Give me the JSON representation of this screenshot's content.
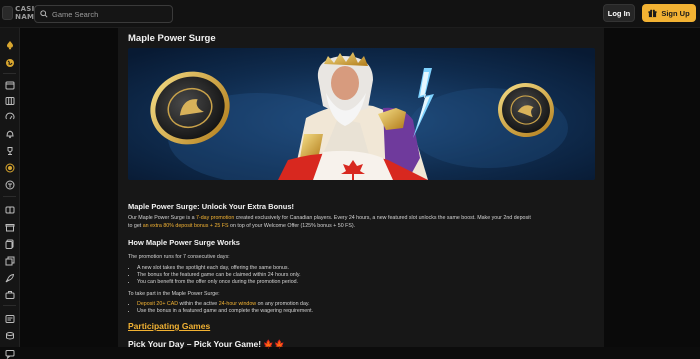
{
  "header": {
    "logo_text": "CASINO NAME",
    "search_placeholder": "Game Search",
    "login_label": "Log In",
    "signup_label": "Sign Up"
  },
  "sidebar": {
    "icons": [
      "spade-icon",
      "world-icon",
      "calendar-icon",
      "slot-machine-icon",
      "speed-icon",
      "bell-icon",
      "trophy-icon",
      "target-icon",
      "dice-icon",
      "slots-reel-icon",
      "gift-icon",
      "card-stack-icon",
      "copy-icon",
      "rocket-icon",
      "briefcase-icon",
      "coins-icon"
    ]
  },
  "article": {
    "title": "Maple Power Surge",
    "hero_alt": "Zeus with Canadian flag and golden coins",
    "heading_1": "Maple Power Surge: Unlock Your Extra Bonus!",
    "intro_line1_a": "Our Maple Power Surge is a ",
    "intro_line1_hl": "7-day promotion",
    "intro_line1_b": " created exclusively for Canadian players. Every 24 hours, a new featured slot unlocks the same boost. Make your 2nd deposit",
    "intro_line2_a": "to get ",
    "intro_line2_hl": "an extra 80% deposit bonus + 25 FS",
    "intro_line2_b": " on top of your Welcome Offer (125% bonus + 50 FS).",
    "heading_2": "How Maple Power Surge Works",
    "runs_text": "The promotion runs for 7 consecutive days:",
    "bullets_1": [
      "A new slot takes the spotlight each day, offering the same bonus.",
      "The bonus for the featured game can be claimed within 24 hours only.",
      "You can benefit from the offer only once during the promotion period."
    ],
    "take_part_text": "To take part in the Maple Power Surge:",
    "bullet_2a_hl1": "Deposit 20+ CAD",
    "bullet_2a_mid": " within the active ",
    "bullet_2a_hl2": "24-hour window",
    "bullet_2a_end": " on any promotion day.",
    "bullet_2b": "Use the bonus in a featured game and complete the wagering requirement.",
    "participating_games": "Participating Games",
    "heading_3": "Pick Your Day – Pick Your Game! 🍁🍁"
  },
  "colors": {
    "accent": "#f2b233",
    "background": "#0a0a0a",
    "panel": "#171717"
  }
}
